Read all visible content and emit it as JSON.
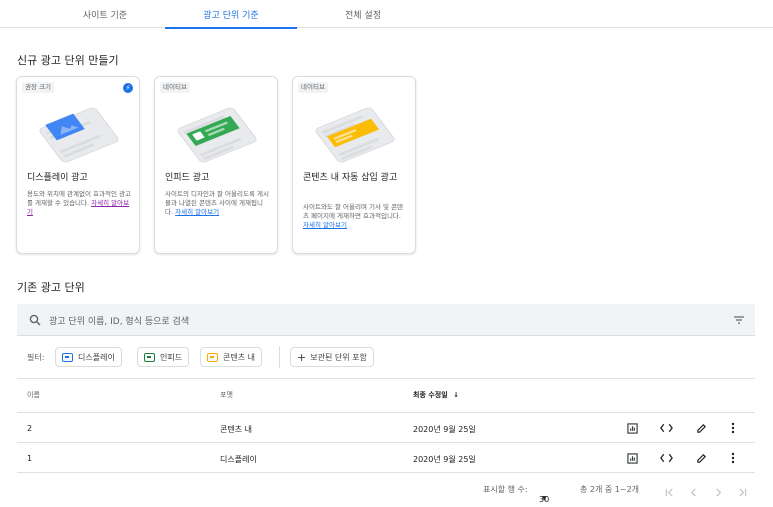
{
  "tabs": [
    "사이트 기준",
    "광고 단위 기준",
    "전체 설정"
  ],
  "create_section_title": "신규 광고 단위 만들기",
  "cards": [
    {
      "chip": "권장 크기",
      "title": "디스플레이 광고",
      "desc": "용도와 위치에 관계없이 효과적인 광고를 게재할 수 있습니다.",
      "link": "자세히 알아보기",
      "accent": "#4285f4"
    },
    {
      "chip": "네이티브",
      "title": "인피드 광고",
      "desc": "사이트의 디자인과 잘 어울리도록 게시물과 나열된 콘텐츠 사이에 게재됩니다.",
      "link": "자세히 알아보기",
      "accent": "#34a853"
    },
    {
      "chip": "네이티브",
      "title": "콘텐츠 내 자동 삽입 광고",
      "desc": "사이트와도 잘 어울리며 기사 및 콘텐츠 페이지에 게재하면 효과적입니다.",
      "link": "자세히 알아보기",
      "accent": "#fbbc04"
    }
  ],
  "existing_section_title": "기존 광고 단위",
  "search": {
    "placeholder": "광고 단위 이름, ID, 형식 등으로 검색"
  },
  "filters": {
    "label": "필터:",
    "chips": [
      {
        "label": "디스플레이",
        "color": "#1a73e8"
      },
      {
        "label": "인피드",
        "color": "#188038"
      },
      {
        "label": "콘텐츠 내",
        "color": "#f9ab00"
      }
    ],
    "archived": "보관된 단위 포함"
  },
  "table": {
    "headers": {
      "name": "이름",
      "format": "포맷",
      "modified": "최종 수정일"
    },
    "rows": [
      {
        "name": "2",
        "format": "콘텐츠 내",
        "modified": "2020년 9월 25일"
      },
      {
        "name": "1",
        "format": "디스플레이",
        "modified": "2020년 9월 25일"
      }
    ]
  },
  "pagination": {
    "rows_label": "표시할 행 수:",
    "rows_value": "30",
    "range": "총 2개 중 1~2개"
  },
  "colors": {
    "accent": "#1a73e8"
  }
}
